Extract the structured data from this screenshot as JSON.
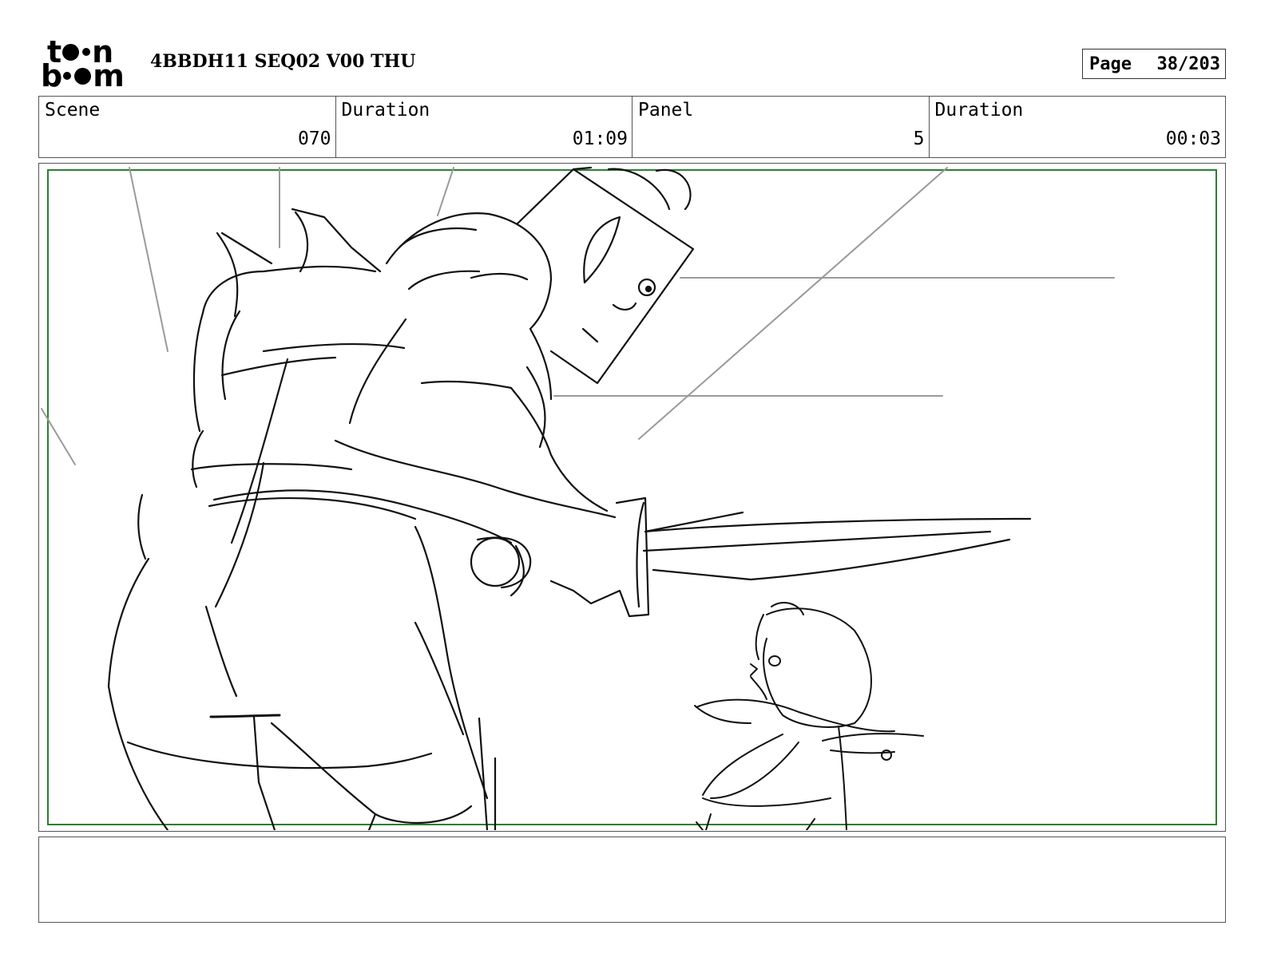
{
  "header": {
    "logo": {
      "line1": [
        "t",
        "n"
      ],
      "line2": [
        "b",
        "m"
      ],
      "brand": "toon boom"
    },
    "title": "4BBDH11 SEQ02 V00 THU",
    "page_label": "Page",
    "page_value": "38/203"
  },
  "info": {
    "scene_label": "Scene",
    "scene_value": "070",
    "duration_label": "Duration",
    "duration_value": "01:09",
    "panel_label": "Panel",
    "panel_value": "5",
    "panel_duration_label": "Duration",
    "panel_duration_value": "00:03"
  },
  "panel": {
    "safe_area_color": "#2e7d32"
  },
  "notes": {
    "text": ""
  }
}
